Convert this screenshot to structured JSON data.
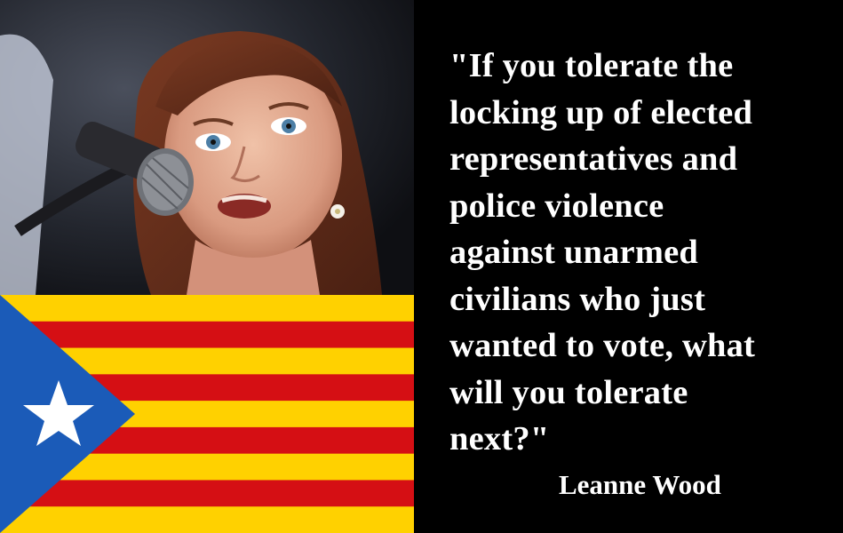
{
  "quote": {
    "text": "\"If you tolerate the\nlocking up of elected\nrepresentatives and\npolice violence\nagainst unarmed\ncivilians who just\nwanted to vote, what\nwill you tolerate\nnext?\""
  },
  "author": {
    "name": "Leanne Wood"
  },
  "flag": {
    "name": "Estelada",
    "colors": {
      "yellow": "#FFD100",
      "red": "#D50F14",
      "triangle": "#1B5BB8",
      "star": "#FFFFFF"
    }
  },
  "photo": {
    "icons": [
      "microphone-icon",
      "earring-icon"
    ]
  }
}
